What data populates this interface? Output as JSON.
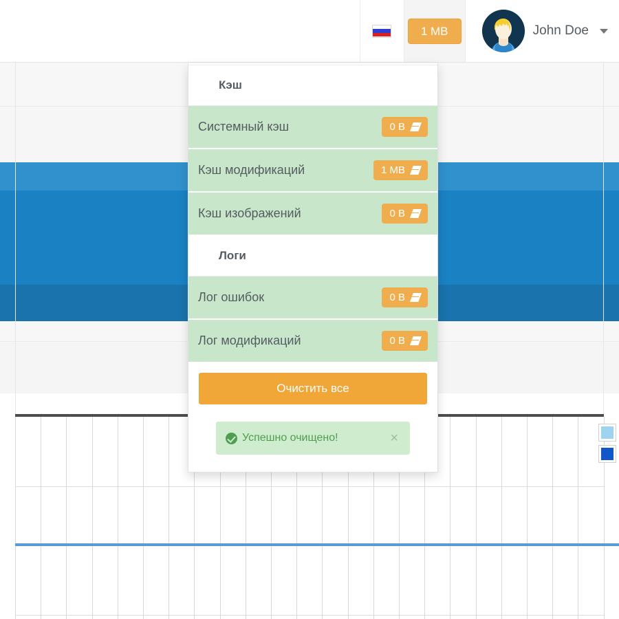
{
  "topbar": {
    "language_flag": "russia-flag-icon",
    "cache_size_button": "1 MB",
    "user_name": "John Doe",
    "caret": "chevron-down-icon",
    "avatar": "user-avatar"
  },
  "panel": {
    "groups": [
      {
        "title": "Кэш",
        "rows": [
          {
            "label": "Системный кэш",
            "value": "0 B",
            "icon": "eraser-icon"
          },
          {
            "label": "Кэш модификаций",
            "value": "1 MB",
            "icon": "eraser-icon"
          },
          {
            "label": "Кэш изображений",
            "value": "0 B",
            "icon": "eraser-icon"
          }
        ]
      },
      {
        "title": "Логи",
        "rows": [
          {
            "label": "Лог ошибок",
            "value": "0 B",
            "icon": "eraser-icon"
          },
          {
            "label": "Лог модификаций",
            "value": "0 B",
            "icon": "eraser-icon"
          }
        ]
      }
    ],
    "clear_all_label": "Очистить все",
    "toast": {
      "icon": "check-circle-icon",
      "message": "Успешно очищено!",
      "close_label": "×"
    }
  },
  "colors": {
    "orange": "#f0ad4e",
    "orange_button": "#f0a738",
    "row_green": "#c8e6c9",
    "toast_green_bg": "#cfeccf",
    "toast_green_text": "#4f9e4f",
    "blue_band_light": "#3091cd",
    "blue_band_mid": "#1a82c3",
    "blue_band_dark": "#1a73ad",
    "series_blue": "#5b9bd5",
    "legend_light_blue": "#9ed4f0",
    "legend_dark_blue": "#1257c8",
    "text_grey": "#555c61"
  },
  "chart_data": {
    "type": "line",
    "title": "",
    "xlabel": "",
    "ylabel": "",
    "grid": true,
    "legend_position": "right",
    "series": [
      {
        "name": "series-light-blue",
        "color": "#9ed4f0",
        "values": []
      },
      {
        "name": "series-dark-blue",
        "color": "#1257c8",
        "values": []
      }
    ],
    "baseline_value": 0,
    "vertical_gridlines": 24,
    "horizontal_gridlines": 3
  }
}
